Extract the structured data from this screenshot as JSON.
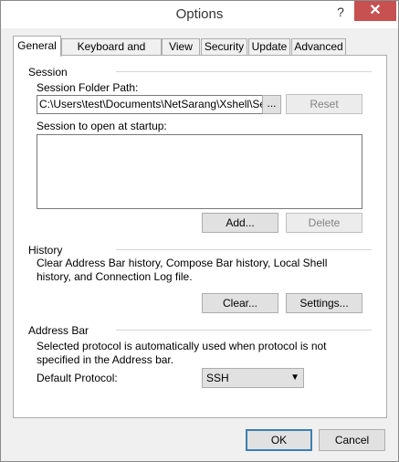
{
  "window": {
    "title": "Options",
    "help_glyph": "?",
    "close_glyph": "✕"
  },
  "tabs": [
    {
      "label": "General",
      "active": true
    },
    {
      "label": "Keyboard and Mouse",
      "active": false
    },
    {
      "label": "View",
      "active": false
    },
    {
      "label": "Security",
      "active": false
    },
    {
      "label": "Update",
      "active": false
    },
    {
      "label": "Advanced",
      "active": false
    }
  ],
  "session": {
    "group_title": "Session",
    "folder_label": "Session Folder Path:",
    "folder_value": "C:\\Users\\test\\Documents\\NetSarang\\Xshell\\Sessi",
    "browse_label": "...",
    "reset_label": "Reset",
    "startup_label": "Session to open at startup:",
    "startup_items": [],
    "add_label": "Add...",
    "delete_label": "Delete"
  },
  "history": {
    "group_title": "History",
    "description": "Clear Address Bar history, Compose Bar history, Local Shell history, and Connection Log file.",
    "clear_label": "Clear...",
    "settings_label": "Settings..."
  },
  "address_bar": {
    "group_title": "Address Bar",
    "description": "Selected protocol is automatically used when protocol is not specified in the Address bar.",
    "protocol_label": "Default Protocol:",
    "protocol_value": "SSH"
  },
  "footer": {
    "ok_label": "OK",
    "cancel_label": "Cancel"
  }
}
